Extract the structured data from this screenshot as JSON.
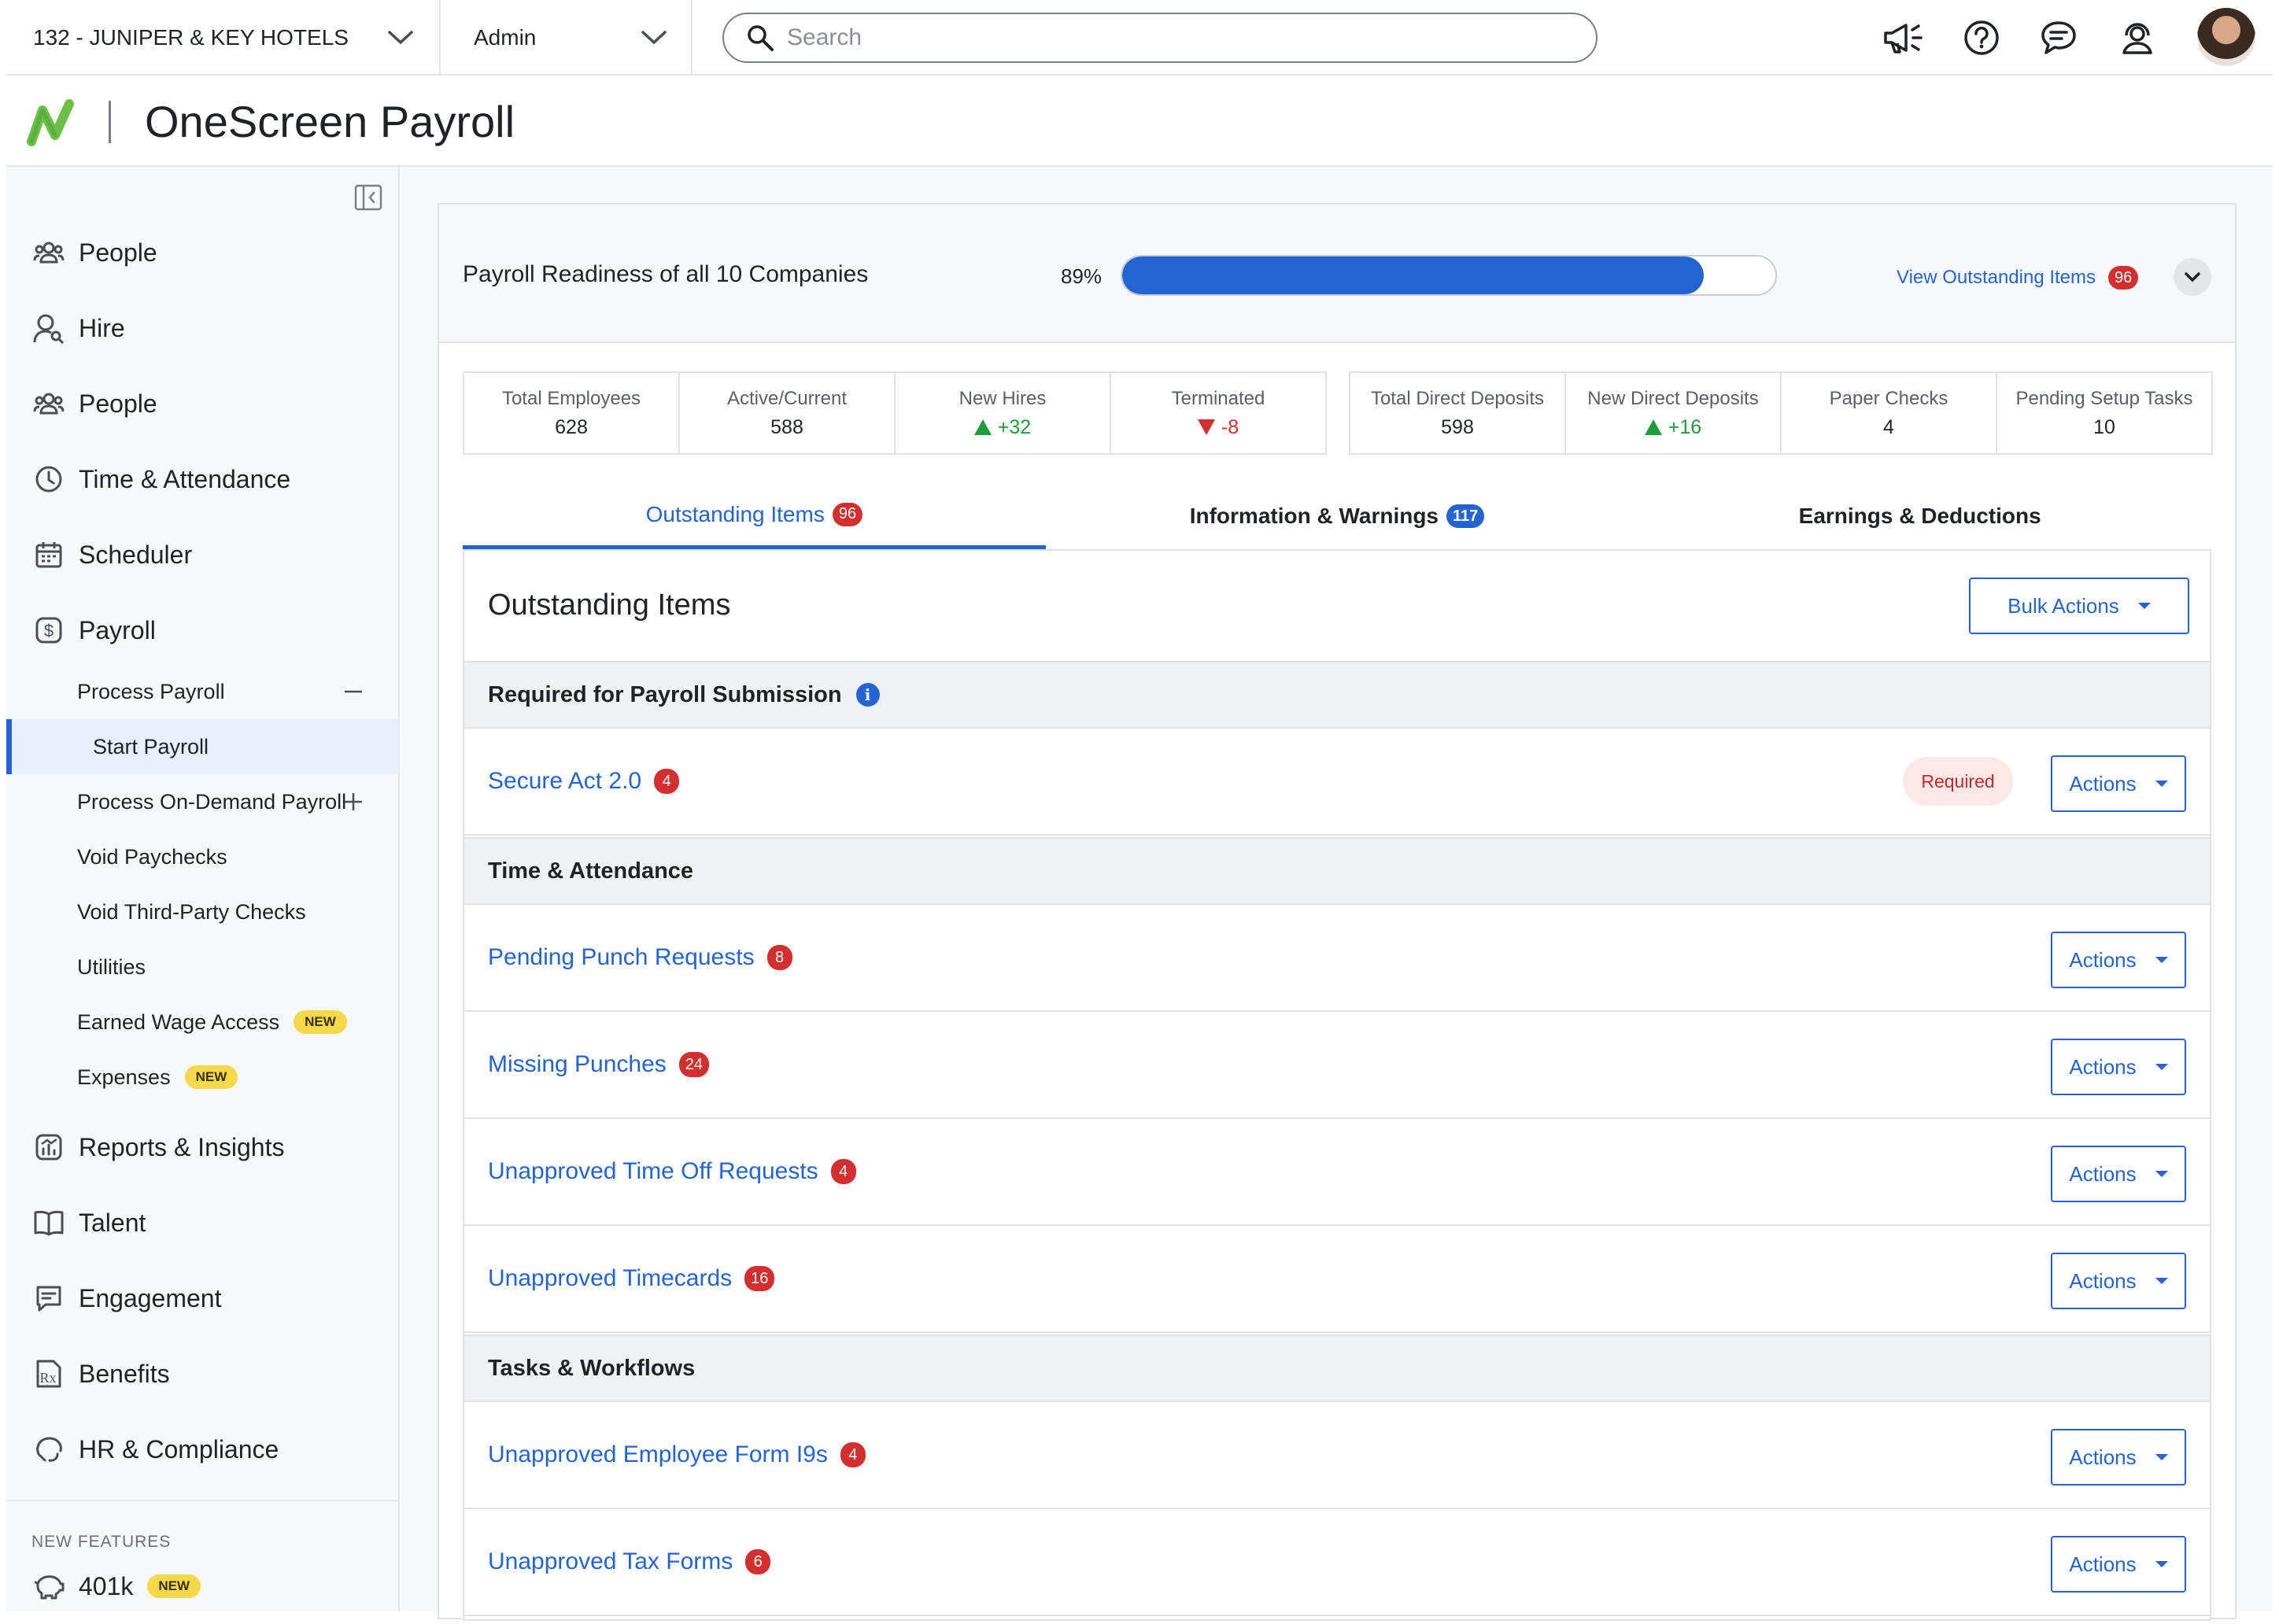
{
  "topbar": {
    "company": "132 - JUNIPER & KEY HOTELS",
    "role": "Admin",
    "search_placeholder": "Search",
    "icons": [
      "megaphone-icon",
      "help-icon",
      "chat-icon",
      "support-agent-icon",
      "avatar"
    ]
  },
  "app": {
    "title": "OneScreen Payroll"
  },
  "sidebar": {
    "items": [
      {
        "label": "People",
        "icon": "people-icon"
      },
      {
        "label": "Hire",
        "icon": "hire-icon"
      },
      {
        "label": "People",
        "icon": "people-icon"
      },
      {
        "label": "Time & Attendance",
        "icon": "clock-icon"
      },
      {
        "label": "Scheduler",
        "icon": "calendar-icon"
      },
      {
        "label": "Payroll",
        "icon": "dollar-icon"
      }
    ],
    "payroll_sub": [
      {
        "label": "Process Payroll",
        "action": "collapse"
      },
      {
        "label": "Start Payroll",
        "active": true
      },
      {
        "label": "Process On-Demand Payroll",
        "action": "expand"
      },
      {
        "label": "Void Paychecks"
      },
      {
        "label": "Void Third-Party Checks"
      },
      {
        "label": "Utilities"
      },
      {
        "label": "Earned Wage Access",
        "badge": "NEW"
      },
      {
        "label": "Expenses",
        "badge": "NEW"
      }
    ],
    "items_after": [
      {
        "label": "Reports & Insights",
        "icon": "reports-icon"
      },
      {
        "label": "Talent",
        "icon": "book-icon"
      },
      {
        "label": "Engagement",
        "icon": "engagement-icon"
      },
      {
        "label": "Benefits",
        "icon": "benefits-icon"
      },
      {
        "label": "HR & Compliance",
        "icon": "hr-compliance-icon"
      }
    ],
    "new_features_label": "NEW FEATURES",
    "new_features": [
      {
        "label": "401k",
        "badge": "NEW",
        "icon": "piggy-bank-icon"
      }
    ]
  },
  "readiness": {
    "label": "Payroll Readiness of all 10 Companies",
    "percent_text": "89%",
    "percent": 89,
    "view_link": "View Outstanding Items",
    "view_count": "96"
  },
  "stats_employees": [
    {
      "label": "Total Employees",
      "value": "628"
    },
    {
      "label": "Active/Current",
      "value": "588"
    },
    {
      "label": "New Hires",
      "value": "+32",
      "trend": "up"
    },
    {
      "label": "Terminated",
      "value": "-8",
      "trend": "down"
    }
  ],
  "stats_payments": [
    {
      "label": "Total Direct Deposits",
      "value": "598"
    },
    {
      "label": "New Direct Deposits",
      "value": "+16",
      "trend": "up"
    },
    {
      "label": "Paper Checks",
      "value": "4"
    },
    {
      "label": "Pending Setup Tasks",
      "value": "10"
    }
  ],
  "tabs": [
    {
      "label": "Outstanding Items",
      "count": "96",
      "active": true
    },
    {
      "label": "Information & Warnings",
      "count": "117"
    },
    {
      "label": "Earnings & Deductions"
    }
  ],
  "panel": {
    "title": "Outstanding Items",
    "bulk_actions": "Bulk Actions",
    "actions_label": "Actions",
    "required_label": "Required",
    "sections": [
      {
        "title": "Required for Payroll Submission",
        "info": "i",
        "items": [
          {
            "label": "Secure Act 2.0",
            "count": "4",
            "required": true
          }
        ]
      },
      {
        "title": "Time & Attendance",
        "items": [
          {
            "label": "Pending Punch Requests",
            "count": "8"
          },
          {
            "label": "Missing Punches",
            "count": "24"
          },
          {
            "label": "Unapproved Time Off Requests",
            "count": "4"
          },
          {
            "label": "Unapproved Timecards",
            "count": "16"
          }
        ]
      },
      {
        "title": "Tasks & Workflows",
        "items": [
          {
            "label": "Unapproved Employee Form I9s",
            "count": "4"
          },
          {
            "label": "Unapproved Tax Forms",
            "count": "6"
          }
        ]
      }
    ]
  },
  "colors": {
    "accent": "#2364d2",
    "badge_red": "#d32f2f",
    "up_green": "#1f9d3a",
    "new_yellow": "#f6d94a",
    "logo_green": "#6cc04a"
  }
}
